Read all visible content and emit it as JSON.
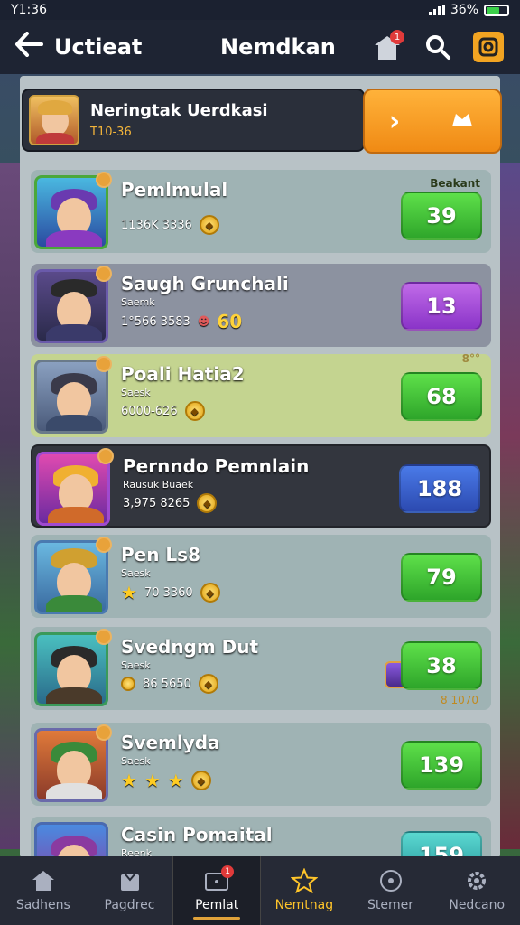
{
  "status_bar": {
    "time": "Y1:36",
    "battery": "36%"
  },
  "header": {
    "left_title": "Uctieat",
    "center_title": "Nemdkan",
    "shop_badge": "1"
  },
  "top_card": {
    "title": "Neringtak Uerdkasi",
    "subtitle": "T10-36"
  },
  "rows": [
    {
      "name": "Pemlmulal",
      "sub": "",
      "stat": "1136K 3336",
      "score": "39",
      "tag": "Beakant",
      "score_color": "green"
    },
    {
      "name": "Saugh Grunchali",
      "sub": "Saemk",
      "stat": "1°566 3583",
      "extra": "60",
      "score": "13",
      "score_color": "purple"
    },
    {
      "name": "Poali Hatia2",
      "sub": "Saesk",
      "stat": "6000-626",
      "score": "68",
      "tag": "8°°",
      "score_color": "green"
    },
    {
      "name": "Pernndo Pemnlain",
      "sub": "Rausuk Buaek",
      "stat": "3,975 8265",
      "score": "188",
      "score_color": "blue"
    },
    {
      "name": "Pen Ls8",
      "sub": "Saesk",
      "stat": "70 3360",
      "score": "79",
      "score_color": "green"
    },
    {
      "name": "Svedngm Dut",
      "sub": "Saesk",
      "stat": "86 5650",
      "score": "38",
      "tag2": "8 1070",
      "score_color": "green"
    },
    {
      "name": "Svemlyda",
      "sub": "Saesk",
      "stat": "",
      "score": "139",
      "score_color": "green"
    },
    {
      "name": "Casin Pomaital",
      "sub": "Reenk",
      "stat": "",
      "score": "159",
      "score_color": "teal"
    }
  ],
  "nav": [
    {
      "label": "Sadhens",
      "icon": "home-icon"
    },
    {
      "label": "Pagdrec",
      "icon": "bag-icon"
    },
    {
      "label": "Pemlat",
      "icon": "inbox-icon",
      "badge": "1"
    },
    {
      "label": "Nemtnag",
      "icon": "star-icon"
    },
    {
      "label": "Stemer",
      "icon": "timer-icon"
    },
    {
      "label": "Nedcano",
      "icon": "gear-icon"
    }
  ]
}
